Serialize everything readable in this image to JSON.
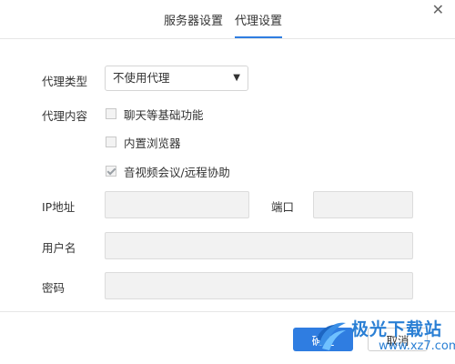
{
  "tabs": [
    {
      "label": "服务器设置",
      "active": false
    },
    {
      "label": "代理设置",
      "active": true
    }
  ],
  "close_icon": "close-icon",
  "proxy_type": {
    "label": "代理类型",
    "selected": "不使用代理"
  },
  "proxy_content": {
    "label": "代理内容",
    "options": [
      {
        "label": "聊天等基础功能",
        "checked": false
      },
      {
        "label": "内置浏览器",
        "checked": false
      },
      {
        "label": "音视频会议/远程协助",
        "checked": true
      }
    ]
  },
  "ip": {
    "label": "IP地址",
    "value": ""
  },
  "port": {
    "label": "端口",
    "value": ""
  },
  "username": {
    "label": "用户名",
    "value": ""
  },
  "password": {
    "label": "密码",
    "value": ""
  },
  "buttons": {
    "ok": "确定",
    "cancel": "取消"
  },
  "watermark": {
    "title": "极光下载站",
    "url": "www.xz7.com"
  },
  "colors": {
    "accent": "#2f7de1",
    "watermark": "#2a7fd4"
  }
}
